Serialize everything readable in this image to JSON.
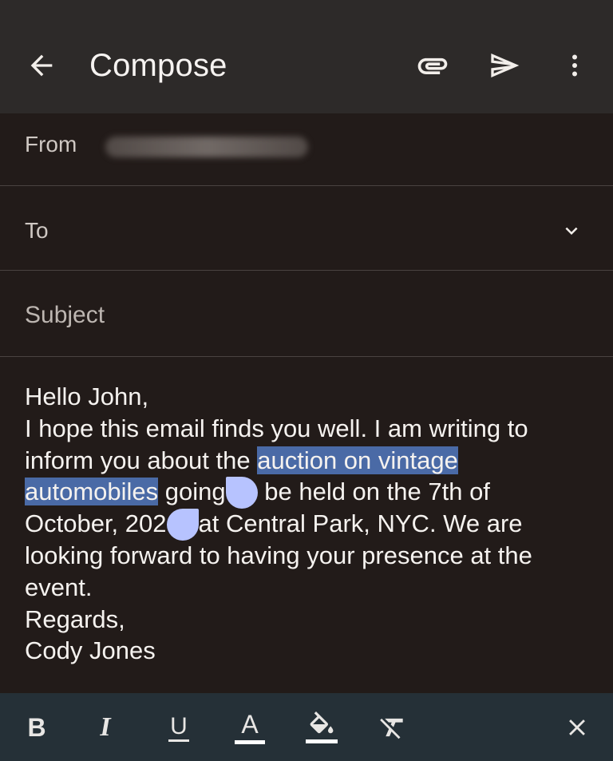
{
  "appbar": {
    "title": "Compose",
    "icons": {
      "back": "arrow-back-icon",
      "attach": "paperclip-icon",
      "send": "send-icon",
      "more": "more-vert-icon"
    }
  },
  "from": {
    "label": "From"
  },
  "to": {
    "label": "To"
  },
  "subject": {
    "placeholder": "Subject",
    "value": ""
  },
  "body": {
    "greeting": "Hello John,",
    "l2": "I hope this email finds you well. I am writing to",
    "l3_pre": "inform you about the ",
    "l3_sel": "auction on vintage",
    "l4_sel": "automobiles",
    "l4_a": " going",
    "l4_b": " be held on the 7th of",
    "l5_a": "October, 202",
    "l5_b": "at Central Park, NYC. We are",
    "l6": "looking forward to having your presence at the",
    "l7": "event.",
    "l8": "Regards,",
    "l9": "Cody Jones"
  },
  "format_toolbar": {
    "bold": "B",
    "italic": "I",
    "underline": "U",
    "text_color": "A",
    "icons": [
      "bold-icon",
      "italic-icon",
      "underline-icon",
      "text-color-icon",
      "fill-color-icon",
      "clear-format-icon",
      "close-icon"
    ]
  },
  "colors": {
    "background": "#221b19",
    "appbar": "#2d2a29",
    "selection": "#4a6aa6",
    "selection_handle": "#b7c3ff",
    "toolbar": "#253037"
  }
}
